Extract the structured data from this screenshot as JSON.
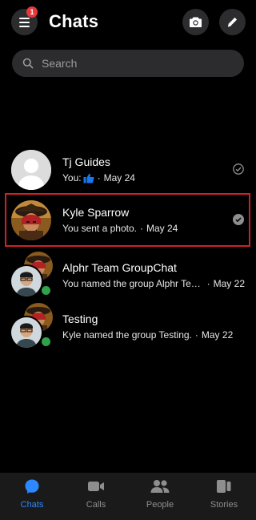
{
  "header": {
    "title": "Chats",
    "menu_badge": "1",
    "icons": {
      "menu": "hamburger-icon",
      "camera": "camera-icon",
      "compose": "pencil-icon"
    }
  },
  "search": {
    "placeholder": "Search",
    "value": ""
  },
  "chats": [
    {
      "name": "Tj Guides",
      "prefix": "You:",
      "message": "",
      "has_like": true,
      "time": "May 24",
      "status": "seen-check",
      "avatar": "default-person"
    },
    {
      "name": "Kyle Sparrow",
      "prefix": "",
      "message": "You sent a photo.",
      "has_like": false,
      "time": "May 24",
      "status": "seen-check",
      "avatar": "pirate-photo",
      "highlighted": true
    },
    {
      "name": "Alphr Team GroupChat",
      "prefix": "",
      "message": "You named the group Alphr Tea...",
      "has_like": false,
      "time": "May 22",
      "status": "online",
      "avatar": "group"
    },
    {
      "name": "Testing",
      "prefix": "",
      "message": "Kyle named the group Testing.",
      "has_like": false,
      "time": "May 22",
      "status": "online",
      "avatar": "group"
    }
  ],
  "separator": "·",
  "bottom_nav": [
    {
      "label": "Chats",
      "icon": "chat-bubble-icon",
      "active": true
    },
    {
      "label": "Calls",
      "icon": "video-camera-icon",
      "active": false
    },
    {
      "label": "People",
      "icon": "people-icon",
      "active": false
    },
    {
      "label": "Stories",
      "icon": "stories-icon",
      "active": false
    }
  ],
  "colors": {
    "accent": "#2d88ff",
    "highlight_border": "#d0202a",
    "badge": "#e4393c",
    "online": "#31a24c"
  }
}
